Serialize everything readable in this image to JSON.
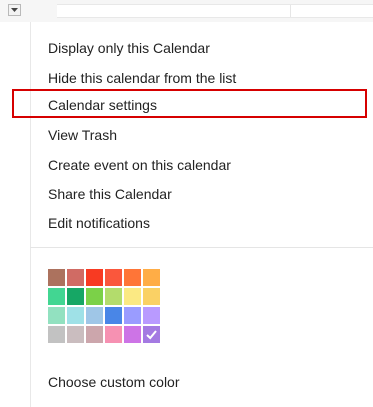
{
  "menu": {
    "items": [
      {
        "label": "Display only this Calendar"
      },
      {
        "label": "Hide this calendar from the list"
      },
      {
        "label": "Calendar settings"
      },
      {
        "label": "View Trash"
      },
      {
        "label": "Create event on this calendar"
      },
      {
        "label": "Share this Calendar"
      },
      {
        "label": "Edit notifications"
      }
    ],
    "highlighted_item": "Calendar settings"
  },
  "palette": {
    "rows": [
      [
        "#ac725e",
        "#d06b64",
        "#f83a22",
        "#fa573c",
        "#ff7537",
        "#ffad46"
      ],
      [
        "#42d692",
        "#16a765",
        "#7bd148",
        "#b3dc6c",
        "#fbe983",
        "#fad165"
      ],
      [
        "#92e1c0",
        "#9fe1e7",
        "#9fc6e7",
        "#4986e7",
        "#9a9cff",
        "#b99aff"
      ],
      [
        "#c2c2c2",
        "#cabdbf",
        "#cca6ac",
        "#f691b2",
        "#cd74e6",
        "#a47ae2"
      ]
    ],
    "selected": {
      "row": 3,
      "col": 5
    },
    "custom_color_label": "Choose custom color"
  },
  "colors": {
    "highlight_border": "#d60000",
    "text": "#222222"
  },
  "icons": {
    "dropdown": "chevron-down-icon",
    "selected_swatch": "checkmark-icon"
  }
}
